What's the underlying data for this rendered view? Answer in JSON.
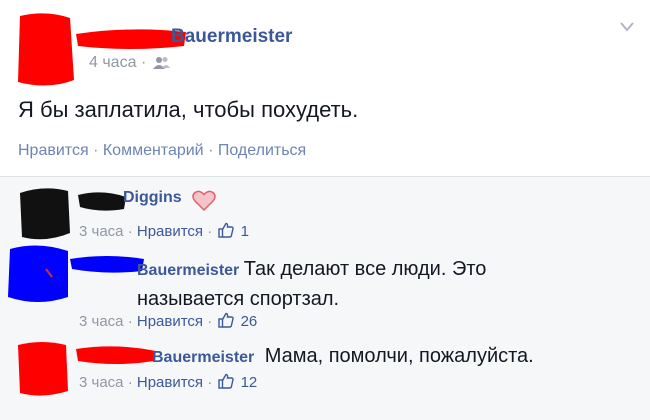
{
  "post": {
    "author": "Bauermeister",
    "time": "4 часа",
    "audience_icon": "friends-icon",
    "text": "Я бы заплатила, чтобы похудеть.",
    "actions": {
      "like": "Нравится",
      "comment": "Комментарий",
      "share": "Поделиться"
    }
  },
  "comments": [
    {
      "author": "Diggins",
      "reaction_icon": "heart-icon",
      "text": "",
      "time": "3 часа",
      "like": "Нравится",
      "likes": "1"
    },
    {
      "author": "Bauermeister",
      "text_line1": "Так делают все люди. Это",
      "text_line2": "называется спортзал.",
      "time": "3 часа",
      "like": "Нравится",
      "likes": "26"
    },
    {
      "author": "Bauermeister",
      "text": "Мама, помолчи, пожалуйста.",
      "time": "3 часа",
      "like": "Нравится",
      "likes": "12"
    }
  ],
  "sep": "·",
  "colors": {
    "link": "#3b5998",
    "meta": "#9197a3",
    "action": "#6d84b4",
    "redact_red": "#ff0000",
    "redact_blue": "#0000ff",
    "redact_black": "#111111",
    "heart": "#e0606e"
  }
}
